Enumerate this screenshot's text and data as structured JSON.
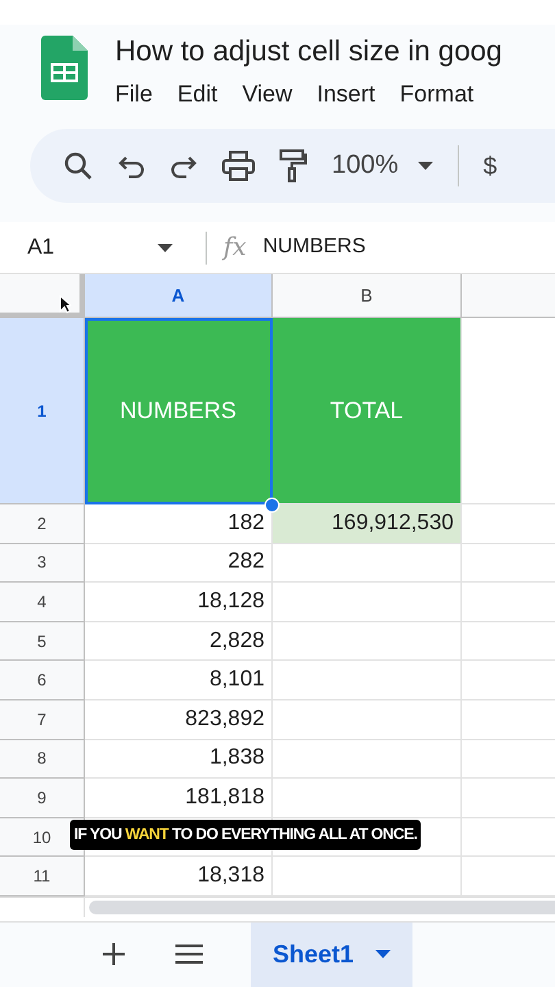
{
  "document": {
    "title": "How to adjust cell size in goog"
  },
  "menu": [
    "File",
    "Edit",
    "View",
    "Insert",
    "Format"
  ],
  "toolbar": {
    "zoom": "100%",
    "currency": "$"
  },
  "formula_bar": {
    "cell_ref": "A1",
    "fx": "fx",
    "value": "NUMBERS"
  },
  "columns": [
    {
      "label": "A",
      "selected": true
    },
    {
      "label": "B",
      "selected": false
    },
    {
      "selected": false
    }
  ],
  "rows": [
    {
      "label": "1",
      "selected": true,
      "cells": [
        {
          "text": "NUMBERS",
          "kind": "header",
          "selected": true
        },
        {
          "text": "TOTAL",
          "kind": "header",
          "selected": false
        }
      ]
    },
    {
      "label": "2",
      "selected": false,
      "cells": [
        {
          "text": "182",
          "kind": "number",
          "selected": false
        },
        {
          "text": "169,912,530",
          "kind": "total",
          "selected": false
        }
      ]
    },
    {
      "label": "3",
      "selected": false,
      "cells": [
        {
          "text": "282",
          "kind": "number",
          "selected": false
        }
      ]
    },
    {
      "label": "4",
      "selected": false,
      "cells": [
        {
          "text": "18,128",
          "kind": "number",
          "selected": false
        }
      ]
    },
    {
      "label": "5",
      "selected": false,
      "cells": [
        {
          "text": "2,828",
          "kind": "number",
          "selected": false
        }
      ]
    },
    {
      "label": "6",
      "selected": false,
      "cells": [
        {
          "text": "8,101",
          "kind": "number",
          "selected": false
        }
      ]
    },
    {
      "label": "7",
      "selected": false,
      "cells": [
        {
          "text": "823,892",
          "kind": "number",
          "selected": false
        }
      ]
    },
    {
      "label": "8",
      "selected": false,
      "cells": [
        {
          "text": "1,838",
          "kind": "number",
          "selected": false
        }
      ]
    },
    {
      "label": "9",
      "selected": false,
      "cells": [
        {
          "text": "181,818",
          "kind": "number",
          "selected": false
        }
      ]
    },
    {
      "label": "10",
      "selected": false,
      "cells": []
    },
    {
      "label": "11",
      "selected": false,
      "cells": [
        {
          "text": "18,318",
          "kind": "number",
          "selected": false
        }
      ]
    }
  ],
  "caption": [
    {
      "text": "IF YOU ",
      "highlighted": false
    },
    {
      "text": "WANT",
      "highlighted": true
    },
    {
      "text": " TO DO EVERYTHING ALL AT ONCE.",
      "highlighted": false
    }
  ],
  "sheet_tabs": [
    {
      "label": "Sheet1",
      "selected": true
    }
  ]
}
